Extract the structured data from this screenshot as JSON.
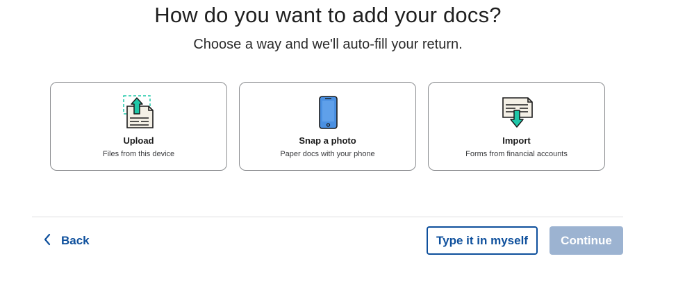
{
  "header": {
    "title": "How do you want to add your docs?",
    "subtitle": "Choose a way and we'll auto-fill your return."
  },
  "options": [
    {
      "title": "Upload",
      "description": "Files from this device",
      "icon": "upload-document-icon"
    },
    {
      "title": "Snap a photo",
      "description": "Paper docs with your phone",
      "icon": "smartphone-icon"
    },
    {
      "title": "Import",
      "description": "Forms from financial accounts",
      "icon": "import-document-icon"
    }
  ],
  "footer": {
    "back_label": "Back",
    "type_it_label": "Type it in myself",
    "continue_label": "Continue"
  },
  "colors": {
    "accent": "#0d4f9c",
    "icon_teal": "#1fc7a8",
    "icon_blue": "#4a90e2",
    "continue_disabled": "#9cb3d1"
  }
}
